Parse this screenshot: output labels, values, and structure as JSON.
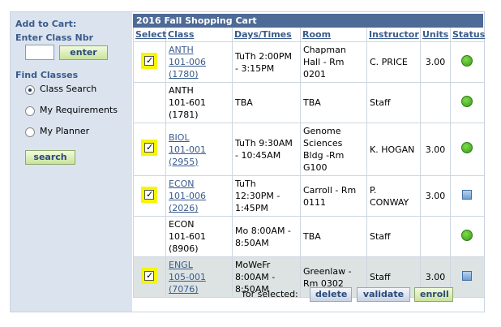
{
  "sidebar": {
    "add_to_cart": "Add to Cart:",
    "enter_class_nbr": "Enter Class Nbr",
    "enter_button": "enter",
    "find_classes": "Find Classes",
    "options": [
      {
        "label": "Class Search",
        "selected": true
      },
      {
        "label": "My Requirements",
        "selected": false
      },
      {
        "label": "My Planner",
        "selected": false
      }
    ],
    "search_button": "search"
  },
  "cart": {
    "title": "2016 Fall Shopping Cart",
    "columns": [
      "Select",
      "Class",
      "Days/Times",
      "Room",
      "Instructor",
      "Units",
      "Status"
    ],
    "rows": [
      {
        "selected": true,
        "class_line1": "ANTH",
        "class_line2": "101-006",
        "class_line3": "(1780)",
        "linked": true,
        "days": "TuTh 2:00PM - 3:15PM",
        "room": "Chapman Hall - Rm 0201",
        "instructor": "C. PRICE",
        "units": "3.00",
        "status": "open"
      },
      {
        "selected": false,
        "class_line1": "ANTH",
        "class_line2": "101-601",
        "class_line3": "(1781)",
        "linked": false,
        "days": "TBA",
        "room": "TBA",
        "instructor": "Staff",
        "units": "",
        "status": "open"
      },
      {
        "selected": true,
        "class_line1": "BIOL",
        "class_line2": "101-001",
        "class_line3": "(2955)",
        "linked": true,
        "days": "TuTh 9:30AM - 10:45AM",
        "room": "Genome Sciences Bldg -Rm G100",
        "instructor": "K. HOGAN",
        "units": "3.00",
        "status": "open"
      },
      {
        "selected": true,
        "class_line1": "ECON",
        "class_line2": "101-006",
        "class_line3": "(2026)",
        "linked": true,
        "days": "TuTh 12:30PM - 1:45PM",
        "room": "Carroll - Rm 0111",
        "instructor": "P. CONWAY",
        "units": "3.00",
        "status": "waitlist"
      },
      {
        "selected": false,
        "class_line1": "ECON",
        "class_line2": "101-601",
        "class_line3": "(8906)",
        "linked": false,
        "days": "Mo 8:00AM - 8:50AM",
        "room": "TBA",
        "instructor": "Staff",
        "units": "",
        "status": "open"
      },
      {
        "selected": true,
        "class_line1": "ENGL",
        "class_line2": "105-001",
        "class_line3": "(7076)",
        "linked": true,
        "days": "MoWeFr 8:00AM - 8:50AM",
        "room": "Greenlaw - Rm 0302",
        "instructor": "Staff",
        "units": "3.00",
        "status": "waitlist",
        "shaded": true
      }
    ]
  },
  "footer": {
    "for_selected": "for selected:",
    "delete_button": "delete",
    "validate_button": "validate",
    "enroll_button": "enroll"
  },
  "colors": {
    "sidebar_bg": "#dbe4ee",
    "title_bar": "#4e6a96",
    "link": "#3a5b8c",
    "open_status": "#3a9a1c",
    "waitlist_status": "#6e9fd3",
    "highlight": "#f6f600"
  }
}
